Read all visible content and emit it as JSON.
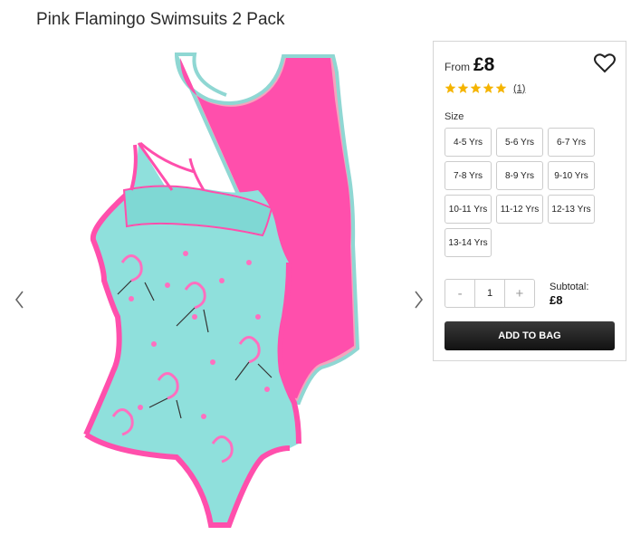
{
  "product": {
    "title": "Pink Flamingo Swimsuits 2 Pack"
  },
  "gallery": {
    "prev_icon": "chevron-left-icon",
    "next_icon": "chevron-right-icon"
  },
  "purchase": {
    "price_prefix": "From",
    "price": "£8",
    "wishlist_icon": "heart-icon",
    "rating": 5,
    "rating_max": 5,
    "review_count": "(1)",
    "star_color": "#f5b400",
    "size_label": "Size",
    "sizes": [
      "4-5 Yrs",
      "5-6 Yrs",
      "6-7 Yrs",
      "7-8 Yrs",
      "8-9 Yrs",
      "9-10 Yrs",
      "10-11 Yrs",
      "11-12 Yrs",
      "12-13 Yrs",
      "13-14 Yrs"
    ],
    "quantity": {
      "minus": "-",
      "value": "1",
      "plus": "+"
    },
    "subtotal_label": "Subtotal:",
    "subtotal_value": "£8",
    "add_to_bag": "ADD TO BAG"
  }
}
